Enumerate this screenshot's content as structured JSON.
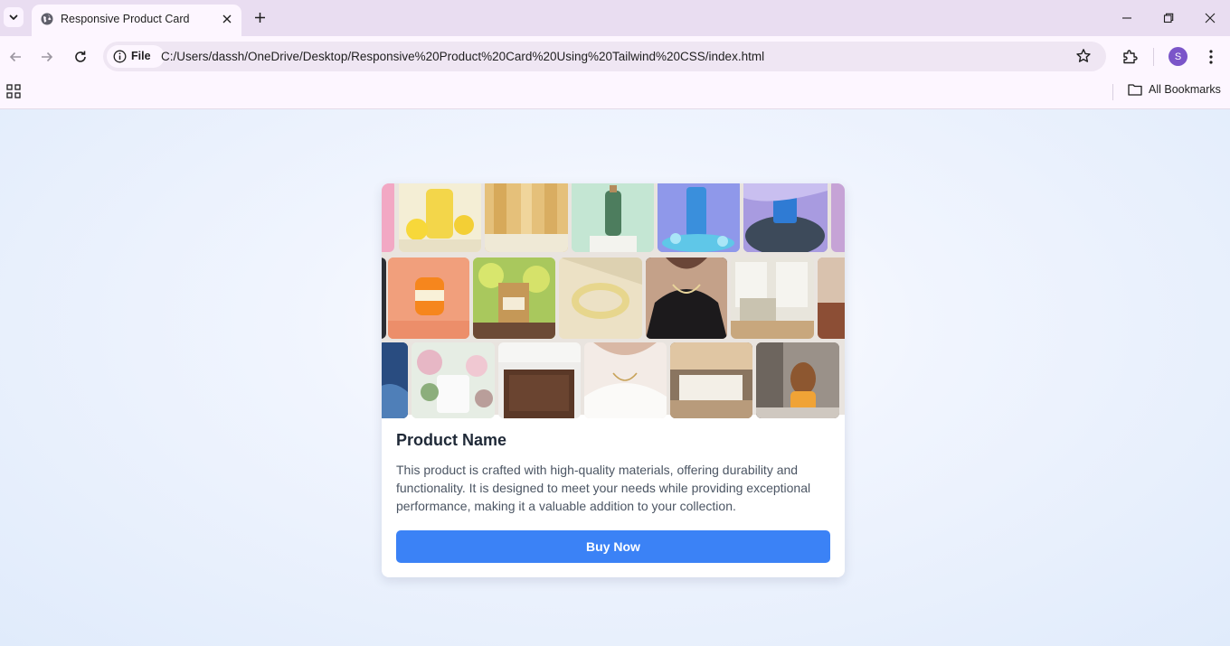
{
  "browser": {
    "tab_title": "Responsive Product Card",
    "chip_label": "File",
    "url": "C:/Users/dassh/OneDrive/Desktop/Responsive%20Product%20Card%20Using%20Tailwind%20CSS/index.html",
    "profile_initial": "S",
    "all_bookmarks": "All Bookmarks"
  },
  "product": {
    "name": "Product Name",
    "description": "This product is crafted with high-quality materials, offering durability and functionality. It is designed to meet your needs while providing exceptional performance, making it a valuable addition to your collection.",
    "button_label": "Buy Now"
  },
  "colors": {
    "button": "#3b82f6",
    "tabbar": "#e9ddf1",
    "toolbar": "#fdf6ff",
    "profile": "#7b55c9"
  }
}
